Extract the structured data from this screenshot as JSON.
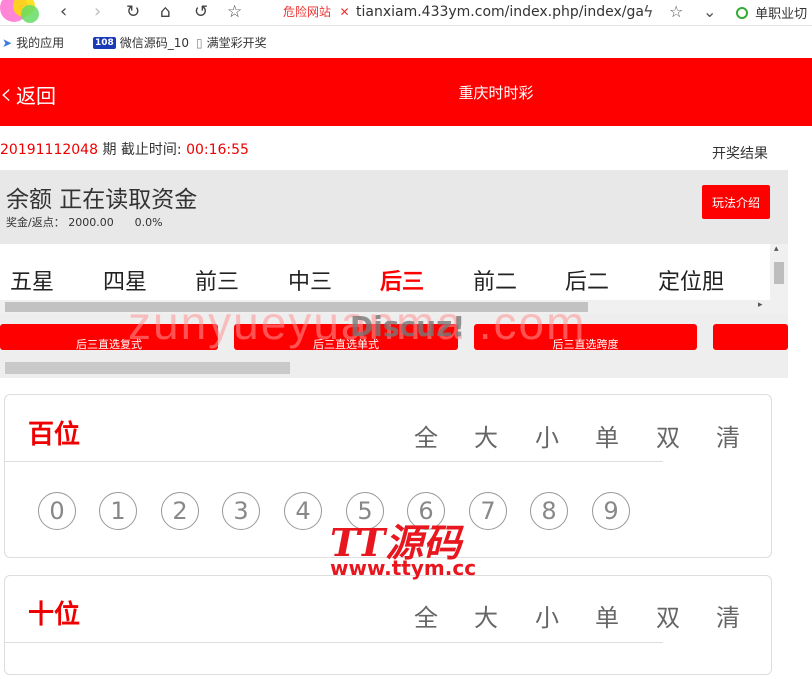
{
  "browser": {
    "danger_label": "危险网站",
    "url": "tianxiam.433ym.com/index.php/index/ga",
    "extension_label": "单职业切",
    "bookmarks": [
      "我的应用",
      "微信源码_10",
      "满堂彩开奖"
    ],
    "bookmark_badge": "108"
  },
  "header": {
    "back_label": "返回",
    "title": "重庆时时彩"
  },
  "period": {
    "number": "20191112048",
    "period_unit": "期",
    "deadline_label": "截止时间:",
    "deadline_value": "00:16:55",
    "results_link": "开奖结果"
  },
  "balance": {
    "title": "余额 正在读取资金",
    "subtitle": "奖金/返点： 2000.00      0.0%",
    "intro_button": "玩法介绍"
  },
  "tabs": [
    "五星",
    "四星",
    "前三",
    "中三",
    "后三",
    "前二",
    "后二",
    "定位胆"
  ],
  "active_tab_index": 4,
  "sub_buttons": [
    "后三直选复式",
    "后三直选单式",
    "后三直选跨度",
    ""
  ],
  "cards": [
    {
      "title": "百位",
      "options": [
        "全",
        "大",
        "小",
        "单",
        "双",
        "清"
      ],
      "digits": [
        "0",
        "1",
        "2",
        "3",
        "4",
        "5",
        "6",
        "7",
        "8",
        "9"
      ]
    },
    {
      "title": "十位",
      "options": [
        "全",
        "大",
        "小",
        "单",
        "双",
        "清"
      ]
    }
  ],
  "watermarks": {
    "text": "zunyueyuanma .com",
    "discuz": "Discuz!",
    "logo": "TT源码",
    "url": "www.ttym.cc"
  },
  "colors": {
    "brand_red": "#ff0000",
    "text_red": "#e00000"
  }
}
